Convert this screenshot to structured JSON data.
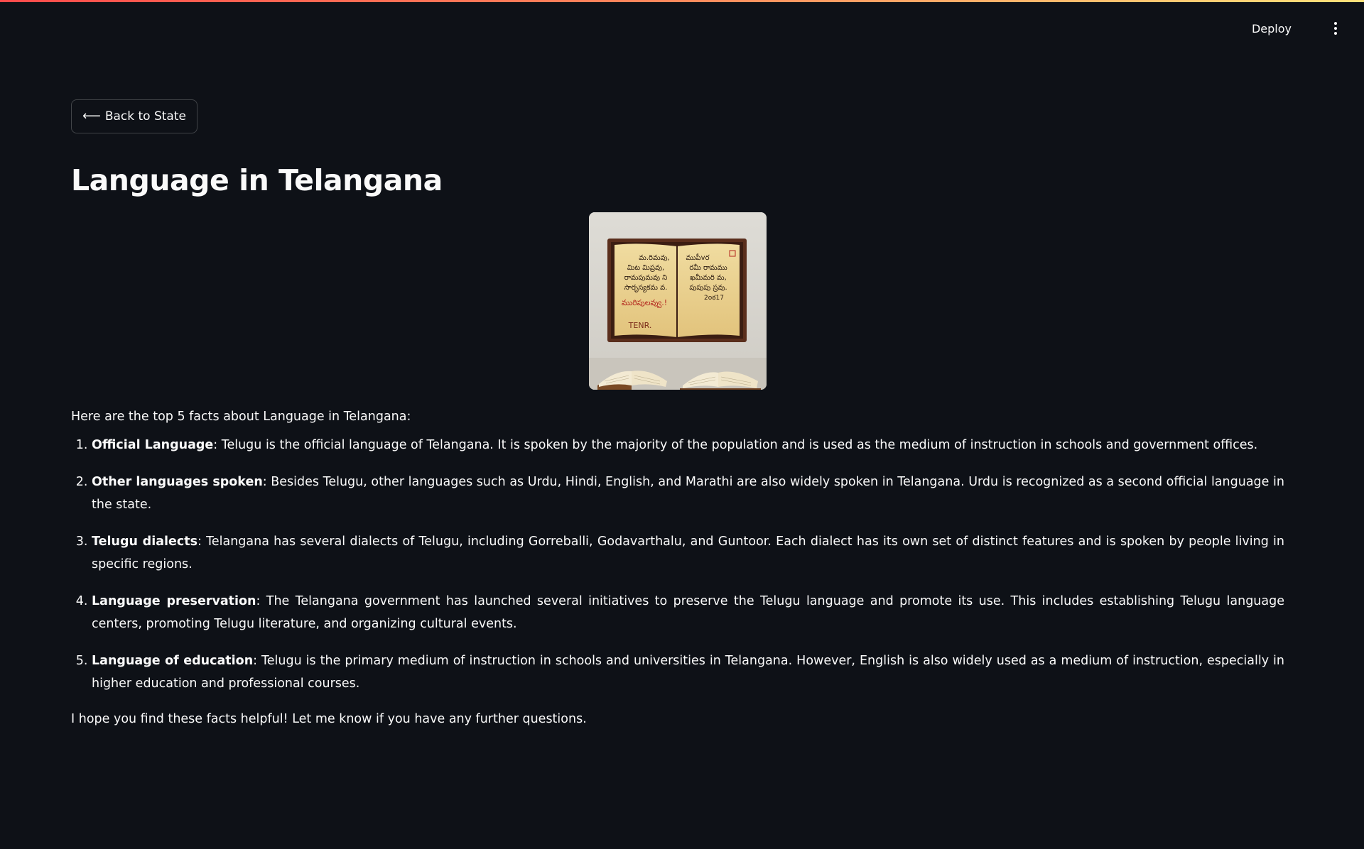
{
  "header": {
    "deploy_label": "Deploy",
    "menu_icon": "more-vertical-icon"
  },
  "back_button": {
    "arrow": "⟵",
    "label": "Back to State"
  },
  "page_title": "Language in Telangana",
  "image": {
    "icon": "telugu-books-image",
    "board_text": {
      "left_lines": [
        "మ.రిమ‌వు,",
        "మిట మిప్రవు,",
        "రామపుమవు ని",
        "సారృస్యకమ వ."
      ],
      "left_red": "మురిపులవ్వు.!",
      "left_sign": "TENR.",
      "right_lines": [
        "ముపీvర",
        "రమీ రామము",
        "ఖమీమరి మ,",
        "పుపుపు స్రవు."
      ],
      "right_number": "2oఠ17"
    }
  },
  "intro": "Here are the top 5 facts about Language in Telangana:",
  "facts": [
    {
      "title": "Official Language",
      "text": ": Telugu is the official language of Telangana. It is spoken by the majority of the population and is used as the medium of instruction in schools and government offices."
    },
    {
      "title": "Other languages spoken",
      "text": ": Besides Telugu, other languages such as Urdu, Hindi, English, and Marathi are also widely spoken in Telangana. Urdu is recognized as a second official language in the state."
    },
    {
      "title": "Telugu dialects",
      "text": ": Telangana has several dialects of Telugu, including Gorreballi, Godavarthalu, and Guntoor. Each dialect has its own set of distinct features and is spoken by people living in specific regions."
    },
    {
      "title": "Language preservation",
      "text": ": The Telangana government has launched several initiatives to preserve the Telugu language and promote its use. This includes establishing Telugu language centers, promoting Telugu literature, and organizing cultural events."
    },
    {
      "title": "Language of education",
      "text": ": Telugu is the primary medium of instruction in schools and universities in Telangana. However, English is also widely used as a medium of instruction, especially in higher education and professional courses."
    }
  ],
  "closing": "I hope you find these facts helpful! Let me know if you have any further questions.",
  "colors": {
    "background": "#0e1117",
    "text": "#fafafa",
    "accent_gradient_start": "#ff4b4b",
    "accent_gradient_end": "#ffe27a"
  }
}
